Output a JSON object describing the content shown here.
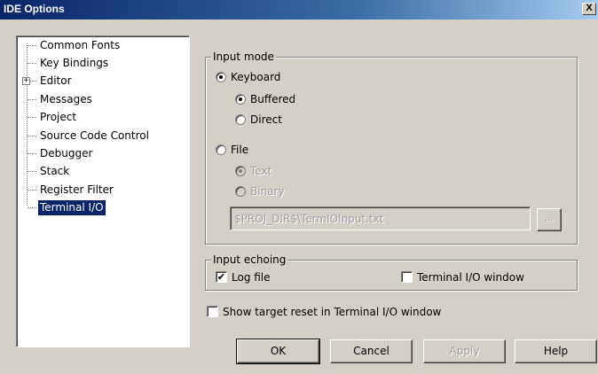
{
  "window": {
    "title": "IDE Options",
    "close_label": "X"
  },
  "tree": {
    "items": [
      {
        "label": "Common Fonts",
        "expandable": false,
        "selected": false
      },
      {
        "label": "Key Bindings",
        "expandable": false,
        "selected": false
      },
      {
        "label": "Editor",
        "expandable": true,
        "selected": false
      },
      {
        "label": "Messages",
        "expandable": false,
        "selected": false
      },
      {
        "label": "Project",
        "expandable": false,
        "selected": false
      },
      {
        "label": "Source Code Control",
        "expandable": false,
        "selected": false
      },
      {
        "label": "Debugger",
        "expandable": false,
        "selected": false
      },
      {
        "label": "Stack",
        "expandable": false,
        "selected": false
      },
      {
        "label": "Register Filter",
        "expandable": false,
        "selected": false
      },
      {
        "label": "Terminal I/O",
        "expandable": false,
        "selected": true
      }
    ],
    "expander_symbol": "+"
  },
  "input_mode": {
    "legend": "Input mode",
    "keyboard": {
      "label": "Keyboard",
      "checked": true
    },
    "buffered": {
      "label": "Buffered",
      "checked": true
    },
    "direct": {
      "label": "Direct",
      "checked": false
    },
    "file": {
      "label": "File",
      "checked": false
    },
    "text": {
      "label": "Text",
      "checked": true,
      "disabled": true
    },
    "binary": {
      "label": "Binary",
      "checked": false,
      "disabled": true
    },
    "file_path": "$PROJ_DIR$\\TermIOInput.txt",
    "browse_label": "..."
  },
  "input_echoing": {
    "legend": "Input echoing",
    "log_file": {
      "label": "Log file",
      "checked": true
    },
    "terminal_window": {
      "label": "Terminal I/O window",
      "checked": false
    }
  },
  "show_target_reset": {
    "label": "Show target reset in Terminal I/O window",
    "checked": false
  },
  "buttons": {
    "ok": "OK",
    "cancel": "Cancel",
    "apply": "Apply",
    "help": "Help"
  },
  "check_mark": "✔"
}
